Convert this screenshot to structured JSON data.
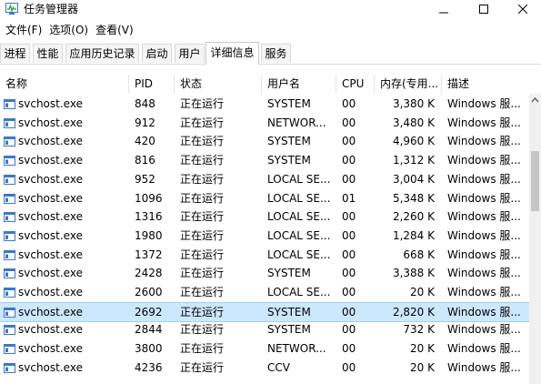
{
  "window": {
    "title": "任务管理器"
  },
  "menu": [
    "文件(F)",
    "选项(O)",
    "查看(V)"
  ],
  "tabs": [
    {
      "label": "进程",
      "active": false
    },
    {
      "label": "性能",
      "active": false
    },
    {
      "label": "应用历史记录",
      "active": false
    },
    {
      "label": "启动",
      "active": false
    },
    {
      "label": "用户",
      "active": false
    },
    {
      "label": "详细信息",
      "active": true
    },
    {
      "label": "服务",
      "active": false
    }
  ],
  "columns": [
    "名称",
    "PID",
    "状态",
    "用户名",
    "CPU",
    "内存(专用...",
    "描述"
  ],
  "sorted_column": "名称",
  "rows": [
    {
      "name": "svchost.exe",
      "pid": "848",
      "status": "正在运行",
      "user": "SYSTEM",
      "cpu": "00",
      "mem": "3,380 K",
      "desc": "Windows 服..."
    },
    {
      "name": "svchost.exe",
      "pid": "912",
      "status": "正在运行",
      "user": "NETWOR...",
      "cpu": "00",
      "mem": "3,480 K",
      "desc": "Windows 服..."
    },
    {
      "name": "svchost.exe",
      "pid": "420",
      "status": "正在运行",
      "user": "SYSTEM",
      "cpu": "00",
      "mem": "4,960 K",
      "desc": "Windows 服..."
    },
    {
      "name": "svchost.exe",
      "pid": "816",
      "status": "正在运行",
      "user": "SYSTEM",
      "cpu": "00",
      "mem": "1,312 K",
      "desc": "Windows 服..."
    },
    {
      "name": "svchost.exe",
      "pid": "952",
      "status": "正在运行",
      "user": "LOCAL SE...",
      "cpu": "00",
      "mem": "3,004 K",
      "desc": "Windows 服..."
    },
    {
      "name": "svchost.exe",
      "pid": "1096",
      "status": "正在运行",
      "user": "LOCAL SE...",
      "cpu": "01",
      "mem": "5,348 K",
      "desc": "Windows 服..."
    },
    {
      "name": "svchost.exe",
      "pid": "1316",
      "status": "正在运行",
      "user": "LOCAL SE...",
      "cpu": "00",
      "mem": "2,260 K",
      "desc": "Windows 服..."
    },
    {
      "name": "svchost.exe",
      "pid": "1980",
      "status": "正在运行",
      "user": "LOCAL SE...",
      "cpu": "00",
      "mem": "1,284 K",
      "desc": "Windows 服..."
    },
    {
      "name": "svchost.exe",
      "pid": "1372",
      "status": "正在运行",
      "user": "LOCAL SE...",
      "cpu": "00",
      "mem": "668 K",
      "desc": "Windows 服..."
    },
    {
      "name": "svchost.exe",
      "pid": "2428",
      "status": "正在运行",
      "user": "SYSTEM",
      "cpu": "00",
      "mem": "3,388 K",
      "desc": "Windows 服..."
    },
    {
      "name": "svchost.exe",
      "pid": "2600",
      "status": "正在运行",
      "user": "LOCAL SE...",
      "cpu": "00",
      "mem": "20 K",
      "desc": "Windows 服..."
    },
    {
      "name": "svchost.exe",
      "pid": "2692",
      "status": "正在运行",
      "user": "SYSTEM",
      "cpu": "00",
      "mem": "2,820 K",
      "desc": "Windows 服...",
      "selected": true
    },
    {
      "name": "svchost.exe",
      "pid": "2844",
      "status": "正在运行",
      "user": "SYSTEM",
      "cpu": "00",
      "mem": "732 K",
      "desc": "Windows 服..."
    },
    {
      "name": "svchost.exe",
      "pid": "3800",
      "status": "正在运行",
      "user": "NETWOR...",
      "cpu": "00",
      "mem": "20 K",
      "desc": "Windows 服..."
    },
    {
      "name": "svchost.exe",
      "pid": "4236",
      "status": "正在运行",
      "user": "CCV",
      "cpu": "00",
      "mem": "20 K",
      "desc": "Windows 服..."
    }
  ],
  "colors": {
    "selection_bg": "#cce8ff",
    "selection_border": "#99d1ff",
    "exe_icon_blue": "#3a78c9"
  }
}
